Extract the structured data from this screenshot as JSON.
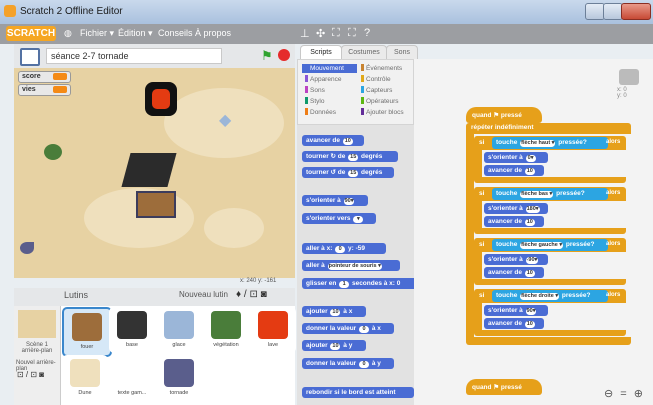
{
  "window": {
    "title": "Scratch 2 Offline Editor"
  },
  "menu": {
    "logo": "SCRATCH",
    "items": [
      "Fichier ▾",
      "Édition ▾",
      "Conseils",
      "À propos"
    ],
    "tools": [
      "⊥",
      "✣",
      "⛶",
      "⛶",
      "?"
    ]
  },
  "stage": {
    "project_name": "séance 2-7 tornade",
    "monitors": [
      {
        "label": "score"
      },
      {
        "label": "vies"
      }
    ],
    "coords": "x: 240  y: -161"
  },
  "sprites": {
    "header": "Lutins",
    "new_sprite_label": "Nouveau lutin",
    "stage_label": "Scène\n1 arrière-plan",
    "new_backdrop_label": "Nouvel arrière-plan",
    "items": [
      {
        "name": "fouer",
        "color": "#9d6d3b",
        "selected": true
      },
      {
        "name": "base",
        "color": "#333333",
        "selected": false
      },
      {
        "name": "glace",
        "color": "#9bb6d8",
        "selected": false
      },
      {
        "name": "végétation",
        "color": "#4a7d3a",
        "selected": false
      },
      {
        "name": "lave",
        "color": "#e43b12",
        "selected": false
      },
      {
        "name": "Dune",
        "color": "#efe0bd",
        "selected": false
      },
      {
        "name": "texte gam...",
        "color": "#ffffff",
        "selected": false
      },
      {
        "name": "tornade",
        "color": "#5a5e8c",
        "selected": false
      }
    ]
  },
  "tabs": [
    "Scripts",
    "Costumes",
    "Sons"
  ],
  "categories": [
    {
      "label": "Mouvement",
      "color": "#4a6cd4",
      "selected": true
    },
    {
      "label": "Apparence",
      "color": "#8a55d7",
      "selected": false
    },
    {
      "label": "Sons",
      "color": "#bb42c3",
      "selected": false
    },
    {
      "label": "Stylo",
      "color": "#0e9a6c",
      "selected": false
    },
    {
      "label": "Données",
      "color": "#ee7d16",
      "selected": false
    },
    {
      "label": "Événements",
      "color": "#c88330",
      "selected": false
    },
    {
      "label": "Contrôle",
      "color": "#e1a91a",
      "selected": false
    },
    {
      "label": "Capteurs",
      "color": "#2ca5e2",
      "selected": false
    },
    {
      "label": "Opérateurs",
      "color": "#5cb712",
      "selected": false
    },
    {
      "label": "Ajouter blocs",
      "color": "#632d99",
      "selected": false
    }
  ],
  "palette_blocks": [
    {
      "pre": "avancer de",
      "num": "10",
      "post": ""
    },
    {
      "pre": "tourner ↻ de",
      "num": "15",
      "post": "degrés"
    },
    {
      "pre": "tourner ↺ de",
      "num": "15",
      "post": "degrés"
    },
    {
      "pre": "s'orienter à",
      "num": "90▾",
      "post": ""
    },
    {
      "pre": "s'orienter vers",
      "num": "▾",
      "post": ""
    },
    {
      "pre": "aller à x:",
      "num": "0",
      "post": "y: -59"
    },
    {
      "pre": "aller à",
      "num": "pointeur de souris ▾",
      "post": ""
    },
    {
      "pre": "glisser en",
      "num": "1",
      "post": "secondes à x: 0"
    },
    {
      "pre": "ajouter",
      "num": "10",
      "post": "à x"
    },
    {
      "pre": "donner la valeur",
      "num": "0",
      "post": "à x"
    },
    {
      "pre": "ajouter",
      "num": "10",
      "post": "à y"
    },
    {
      "pre": "donner la valeur",
      "num": "0",
      "post": "à y"
    },
    {
      "pre": "rebondir si le bord est atteint",
      "num": "",
      "post": ""
    }
  ],
  "script": {
    "hat": "quand ⚑ pressé",
    "forever": "répéter indéfiniment",
    "ifs": [
      {
        "cond_pre": "touche",
        "key": "flèche haut ▾",
        "cond_post": "pressée?",
        "alors": "alors",
        "dir": "0▾",
        "step": "10"
      },
      {
        "cond_pre": "touche",
        "key": "flèche bas ▾",
        "cond_post": "pressée?",
        "alors": "alors",
        "dir": "180▾",
        "step": "10"
      },
      {
        "cond_pre": "touche",
        "key": "flèche gauche ▾",
        "cond_post": "pressée?",
        "alors": "alors",
        "dir": "-90▾",
        "step": "10"
      },
      {
        "cond_pre": "touche",
        "key": "flèche droite ▾",
        "cond_post": "pressée?",
        "alors": "alors",
        "dir": "90▾",
        "step": "10"
      }
    ],
    "orient_label": "s'orienter à",
    "move_label": "avancer de",
    "hat2": "quand ⚑ pressé"
  },
  "zoom": "⊖ = ⊕"
}
